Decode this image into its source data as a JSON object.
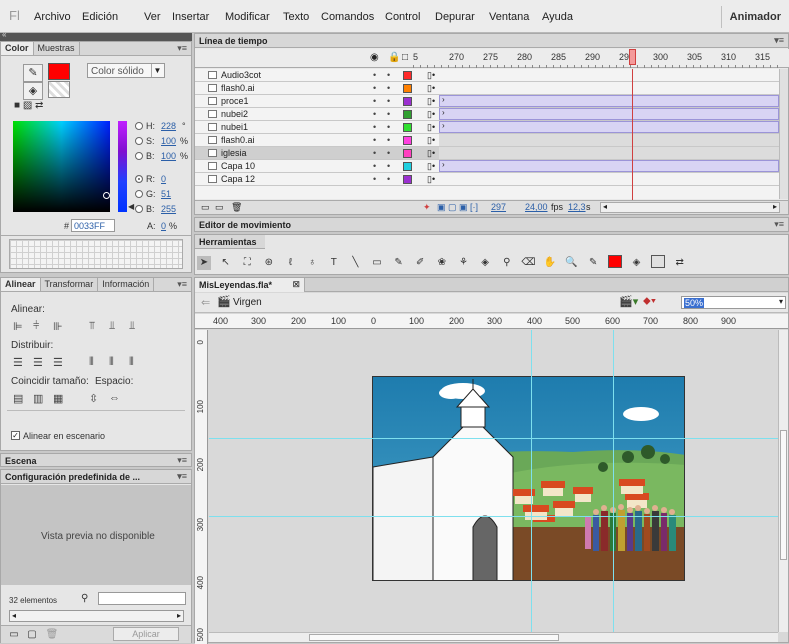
{
  "app": {
    "logo": "Fl",
    "workspace": "Animador"
  },
  "menu": [
    "Archivo",
    "Edición",
    "Ver",
    "Insertar",
    "Modificar",
    "Texto",
    "Comandos",
    "Control",
    "Depurar",
    "Ventana",
    "Ayuda"
  ],
  "color_panel": {
    "tabs": [
      "Color",
      "Muestras"
    ],
    "fill_type": "Color sólido",
    "stroke_color": "#ff0000",
    "fill_color": "#0033ff",
    "h_label": "H:",
    "h_value": "228",
    "h_unit": "°",
    "s_label": "S:",
    "s_value": "100",
    "s_unit": "%",
    "b_label": "B:",
    "b_value": "100",
    "b_unit": "%",
    "r_label": "R:",
    "r_value": "0",
    "g_label": "G:",
    "g_value": "51",
    "bb_label": "B:",
    "bb_value": "255",
    "hex_prefix": "#",
    "hex": "0033FF",
    "alpha_label": "A:",
    "alpha_value": "0",
    "alpha_unit": "%"
  },
  "align_panel": {
    "tabs": [
      "Alinear",
      "Transformar",
      "Información"
    ],
    "align_label": "Alinear:",
    "distribute_label": "Distribuir:",
    "match_size_label": "Coincidir tamaño:",
    "spacing_label": "Espacio:",
    "stage_checkbox": "Alinear en escenario",
    "stage_checked": true
  },
  "scene_panel": {
    "title": "Escena"
  },
  "presets_panel": {
    "title": "Configuración predefinida de ...",
    "preview": "Vista previa no disponible",
    "count": "32 elementos",
    "apply": "Aplicar"
  },
  "timeline": {
    "title": "Línea de tiempo",
    "ruler": [
      "5",
      "270",
      "275",
      "280",
      "285",
      "290",
      "295",
      "300",
      "305",
      "310",
      "315"
    ],
    "layers": [
      {
        "name": "Audio3cot",
        "color": "#ff2a2a"
      },
      {
        "name": "flash0.ai",
        "color": "#ff8000"
      },
      {
        "name": "proce1",
        "color": "#9b30d0"
      },
      {
        "name": "nubei2",
        "color": "#30a030"
      },
      {
        "name": "nubei1",
        "color": "#30e030"
      },
      {
        "name": "flash0.ai",
        "color": "#ff40e0"
      },
      {
        "name": "iglesia",
        "color": "#ff40c0"
      },
      {
        "name": "Capa 10",
        "color": "#20d0e0"
      },
      {
        "name": "Capa 12",
        "color": "#9b30d0"
      }
    ],
    "frame": "297",
    "fps": "24,00",
    "fps_unit": "fps",
    "time": "12,3",
    "time_unit": "s"
  },
  "motion_editor": {
    "title": "Editor de movimiento"
  },
  "tools": {
    "title": "Herramientas",
    "stroke": "#ff0000",
    "fill": "#e0e0e0"
  },
  "document": {
    "tab": "MisLeyendas.fla*",
    "scene": "Virgen",
    "zoom": "50%",
    "hruler": [
      "400",
      "300",
      "200",
      "100",
      "0",
      "100",
      "200",
      "300",
      "400",
      "500",
      "600",
      "700",
      "800",
      "900"
    ],
    "vruler": [
      "0",
      "100",
      "200",
      "300",
      "400",
      "500"
    ]
  }
}
